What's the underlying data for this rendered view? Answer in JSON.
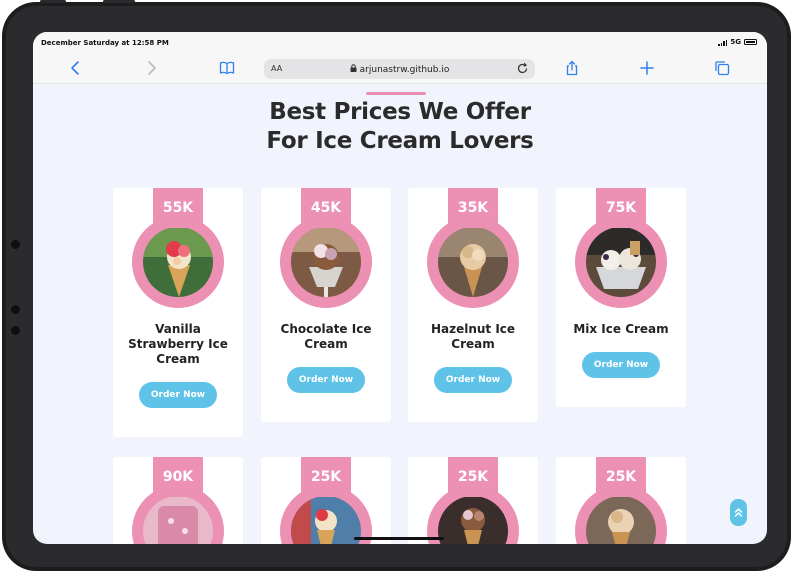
{
  "status_bar": {
    "time": "December Saturday at 12:58 PM",
    "network": "5G"
  },
  "browser": {
    "text_size_label": "AA",
    "url": "arjunastrw.github.io"
  },
  "page": {
    "heading_line1": "Best Prices We Offer",
    "heading_line2": "For Ice Cream Lovers",
    "products_row1": [
      {
        "price": "55K",
        "name": "Vanilla Strawberry Ice Cream",
        "button": "Order Now"
      },
      {
        "price": "45K",
        "name": "Chocolate Ice Cream",
        "button": "Order Now"
      },
      {
        "price": "35K",
        "name": "Hazelnut Ice Cream",
        "button": "Order Now"
      },
      {
        "price": "75K",
        "name": "Mix Ice Cream",
        "button": "Order Now"
      }
    ],
    "products_row2": [
      {
        "price": "90K"
      },
      {
        "price": "25K"
      },
      {
        "price": "25K"
      },
      {
        "price": "25K"
      }
    ]
  },
  "colors": {
    "accent_pink": "#ec90b4",
    "button_blue": "#5fc3e7",
    "page_background": "#f1f4fd"
  }
}
